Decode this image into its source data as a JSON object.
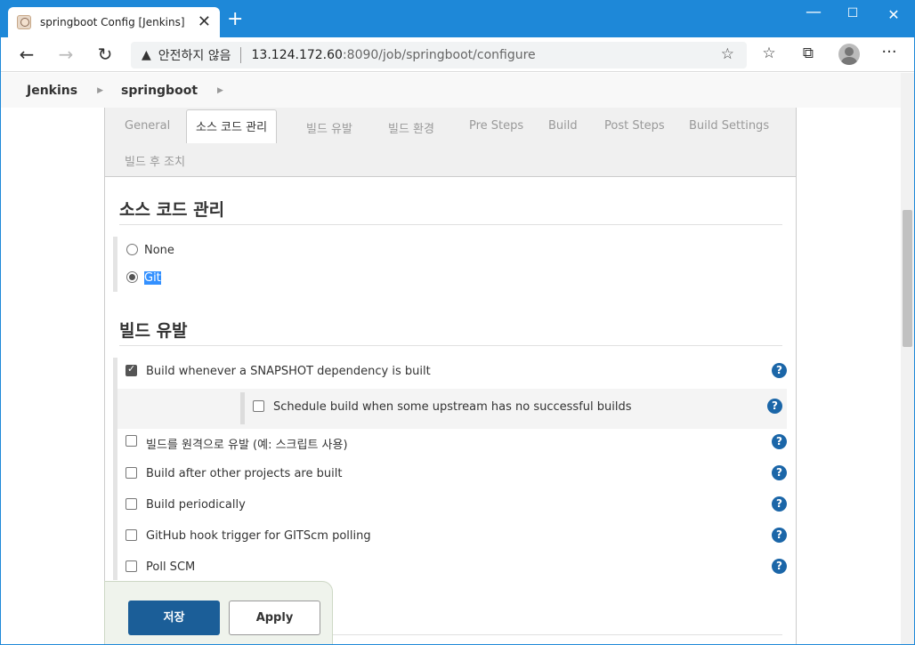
{
  "browser": {
    "tab_title": "springboot Config [Jenkins]",
    "tab_close": "✕",
    "new_tab": "+",
    "window_controls": {
      "minimize": "—",
      "maximize": "☐",
      "close": "✕"
    },
    "insecure_label": "안전하지 않음",
    "url_host": "13.124.172.60",
    "url_path": ":8090/job/springboot/configure"
  },
  "breadcrumb": {
    "items": [
      "Jenkins",
      "springboot"
    ]
  },
  "tabs": {
    "items": [
      "General",
      "소스 코드 관리",
      "빌드 유발",
      "빌드 환경",
      "Pre Steps",
      "Build",
      "Post Steps",
      "Build Settings",
      "빌드 후 조치"
    ],
    "active": "소스 코드 관리"
  },
  "scm": {
    "title": "소스 코드 관리",
    "options": [
      {
        "label": "None",
        "checked": false
      },
      {
        "label": "Git",
        "checked": true
      }
    ]
  },
  "triggers": {
    "title": "빌드 유발",
    "snapshot": "Build whenever a SNAPSHOT dependency is built",
    "schedule_upstream": "Schedule build when some upstream has no successful builds",
    "remote": "빌드를 원격으로 유발 (예: 스크립트 사용)",
    "after_other": "Build after other projects are built",
    "periodically": "Build periodically",
    "github_hook": "GitHub hook trigger for GITScm polling",
    "poll_scm": "Poll SCM"
  },
  "help_symbol": "?",
  "buttons": {
    "save": "저장",
    "apply": "Apply"
  },
  "colors": {
    "title_bar": "#1e88d8",
    "save_button": "#1b5e98",
    "help_icon": "#1b66a8",
    "selection": "#3390ff"
  }
}
